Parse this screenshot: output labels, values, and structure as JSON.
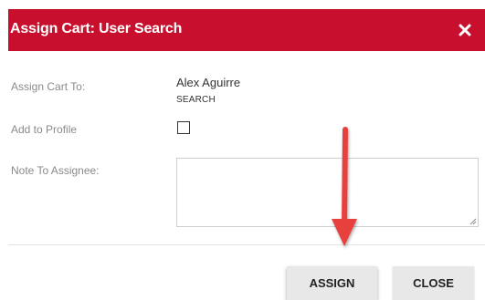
{
  "dialog": {
    "title": "Assign Cart: User Search",
    "close_icon": "close-x-icon"
  },
  "form": {
    "assign_to_label": "Assign Cart To:",
    "assignee_name": "Alex Aguirre",
    "search_link": "SEARCH",
    "add_to_profile_label": "Add to Profile",
    "add_to_profile_checked": false,
    "note_label": "Note To Assignee:",
    "note_value": ""
  },
  "footer": {
    "assign_label": "ASSIGN",
    "close_label": "CLOSE"
  },
  "annotation": {
    "icon": "red-arrow-pointing-down",
    "color": "#e8403c"
  },
  "colors": {
    "header_bg": "#c8102e",
    "button_bg": "#e8e8e8"
  }
}
